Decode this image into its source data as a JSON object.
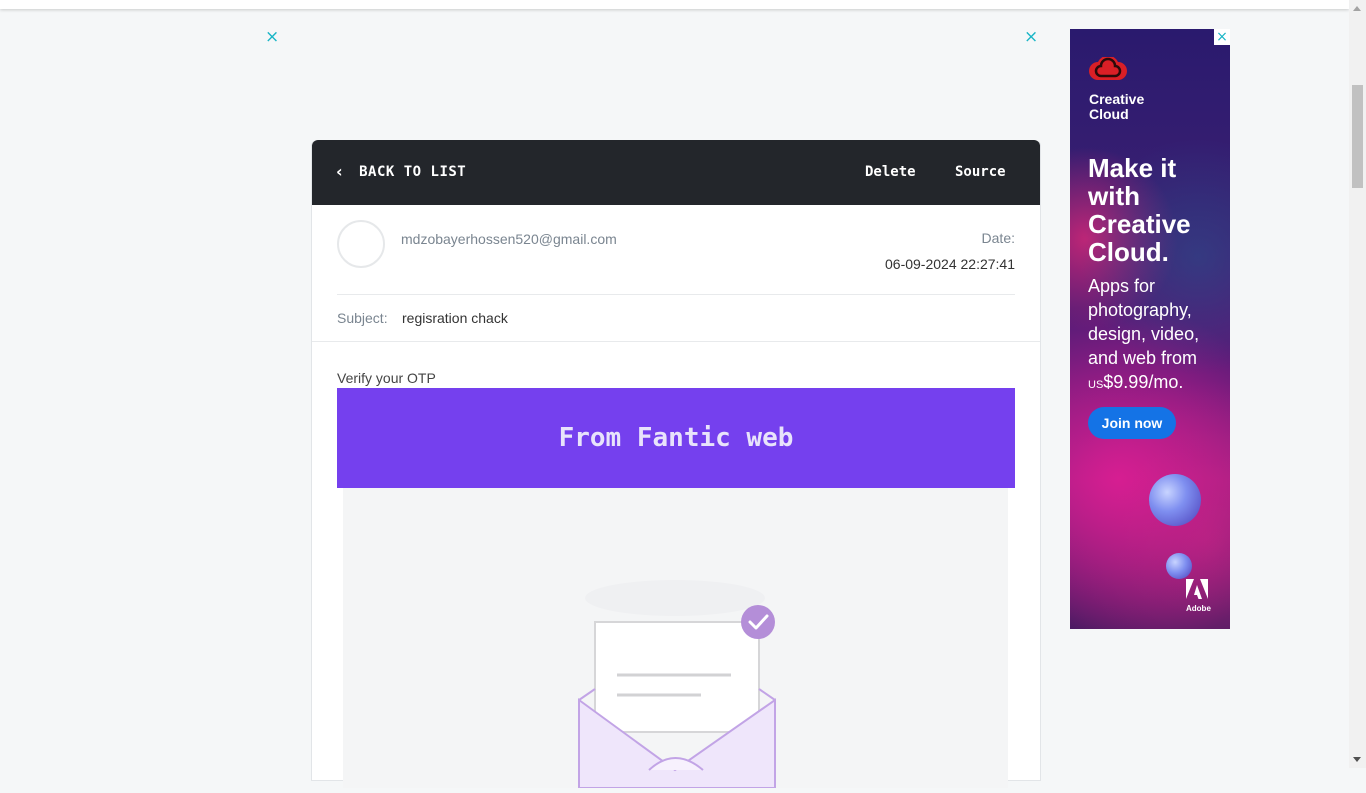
{
  "page": {
    "close_symbol": "×"
  },
  "mail": {
    "back_label": "BACK TO LIST",
    "delete_label": "Delete",
    "source_label": "Source",
    "sender": "mdzobayerhossen520@gmail.com",
    "date_label": "Date:",
    "date_value": "06-09-2024 22:27:41",
    "subject_label": "Subject:",
    "subject_value": "regisration chack",
    "preheader": "Verify your OTP",
    "banner_text": "From Fantic web"
  },
  "ad": {
    "brand_name": "Creative Cloud",
    "headline": "Make it with Creative Cloud.",
    "body": "Apps for photography, design, video, and web from",
    "price_prefix": "US",
    "price": "$9.99/mo.",
    "cta": "Join now",
    "logo_word": "Adobe"
  },
  "colors": {
    "accent": "#18b5c6",
    "banner": "#7540ee",
    "header_dark": "#23262b",
    "cta": "#1473e6"
  }
}
